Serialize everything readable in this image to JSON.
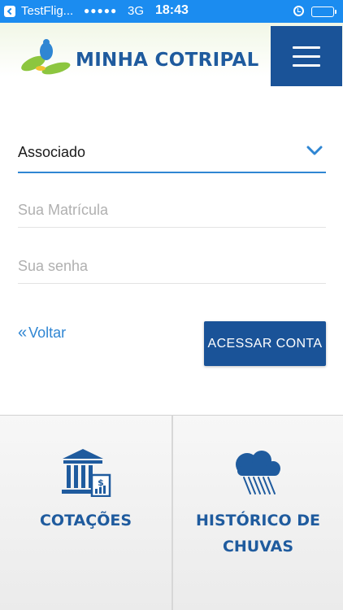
{
  "status_bar": {
    "app": "TestFlig...",
    "signal": "●●●●●",
    "network": "3G",
    "time": "18:43"
  },
  "header": {
    "brand": "MINHA COTRIPAL"
  },
  "form": {
    "account_type": "Associado",
    "matricula_placeholder": "Sua Matrícula",
    "senha_placeholder": "Sua senha",
    "back_label": "Voltar",
    "submit_label": "ACESSAR CONTA"
  },
  "tiles": [
    {
      "label": "COTAÇÕES",
      "icon": "bank-icon"
    },
    {
      "label": "HISTÓRICO DE CHUVAS",
      "icon": "rain-cloud-icon"
    }
  ],
  "colors": {
    "status_bar": "#1b8cf0",
    "brand_blue": "#1a5398",
    "accent_blue": "#2f86d3",
    "logo_green": "#8cc63f"
  }
}
